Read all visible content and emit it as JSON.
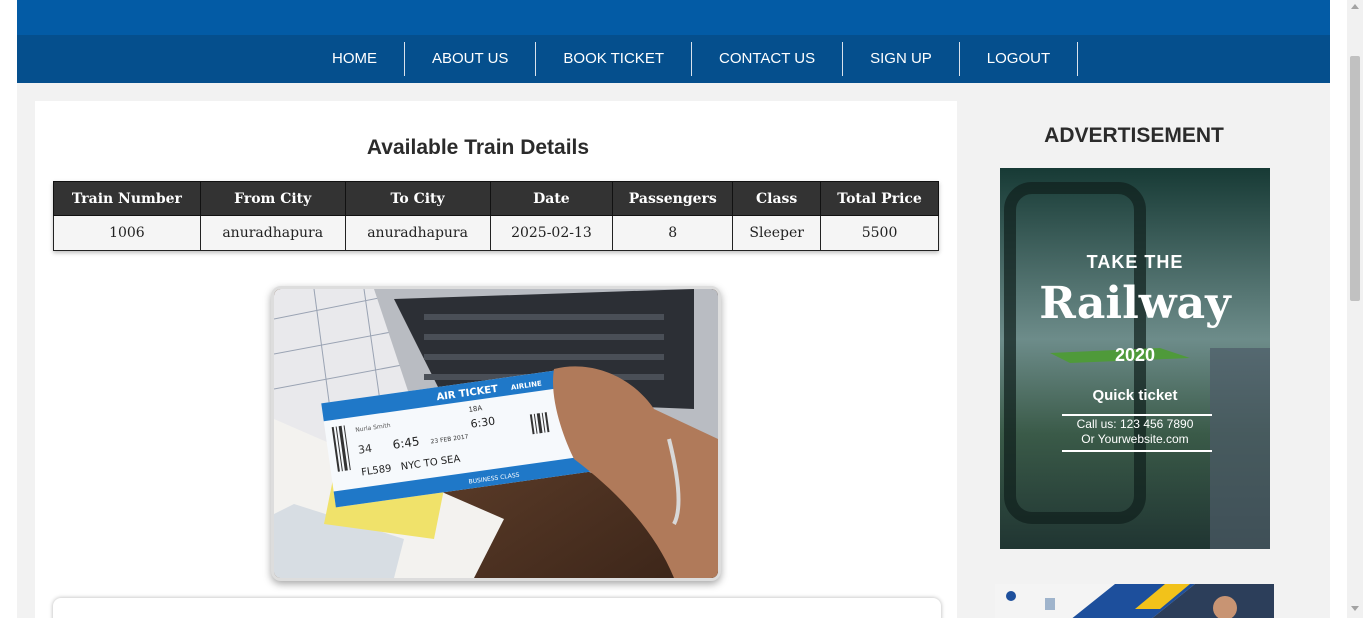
{
  "nav": {
    "items": [
      {
        "label": "HOME"
      },
      {
        "label": "ABOUT US"
      },
      {
        "label": "BOOK TICKET"
      },
      {
        "label": "CONTACT US"
      },
      {
        "label": "SIGN UP"
      },
      {
        "label": "LOGOUT"
      }
    ]
  },
  "main": {
    "title": "Available Train Details",
    "table": {
      "headers": [
        "Train Number",
        "From City",
        "To City",
        "Date",
        "Passengers",
        "Class",
        "Total Price"
      ],
      "rows": [
        [
          "1006",
          "anuradhapura",
          "anuradhapura",
          "2025-02-13",
          "8",
          "Sleeper",
          "5500"
        ]
      ]
    },
    "photo": {
      "ticket_label": "AIR TICKET",
      "airline": "AIRLINE",
      "passenger": "Nurla Smith",
      "seat": "34",
      "time": "6:45",
      "date": "23 FEB 2017",
      "boarding": "6:30",
      "gate": "18A",
      "flight": "FL589",
      "route": "NYC TO SEA",
      "class_label": "BUSINESS CLASS"
    }
  },
  "sidebar": {
    "title": "ADVERTISEMENT",
    "ad": {
      "line1": "TAKE THE",
      "line2": "Railway",
      "year": "2020",
      "tagline": "Quick ticket",
      "call": "Call us: 123 456 7890",
      "website": "Or Yourwebsite.com"
    }
  },
  "colors": {
    "top_band": "#035ba5",
    "nav_bar": "#054f8d",
    "table_header": "#333333",
    "page_background": "#f2f2f2"
  }
}
